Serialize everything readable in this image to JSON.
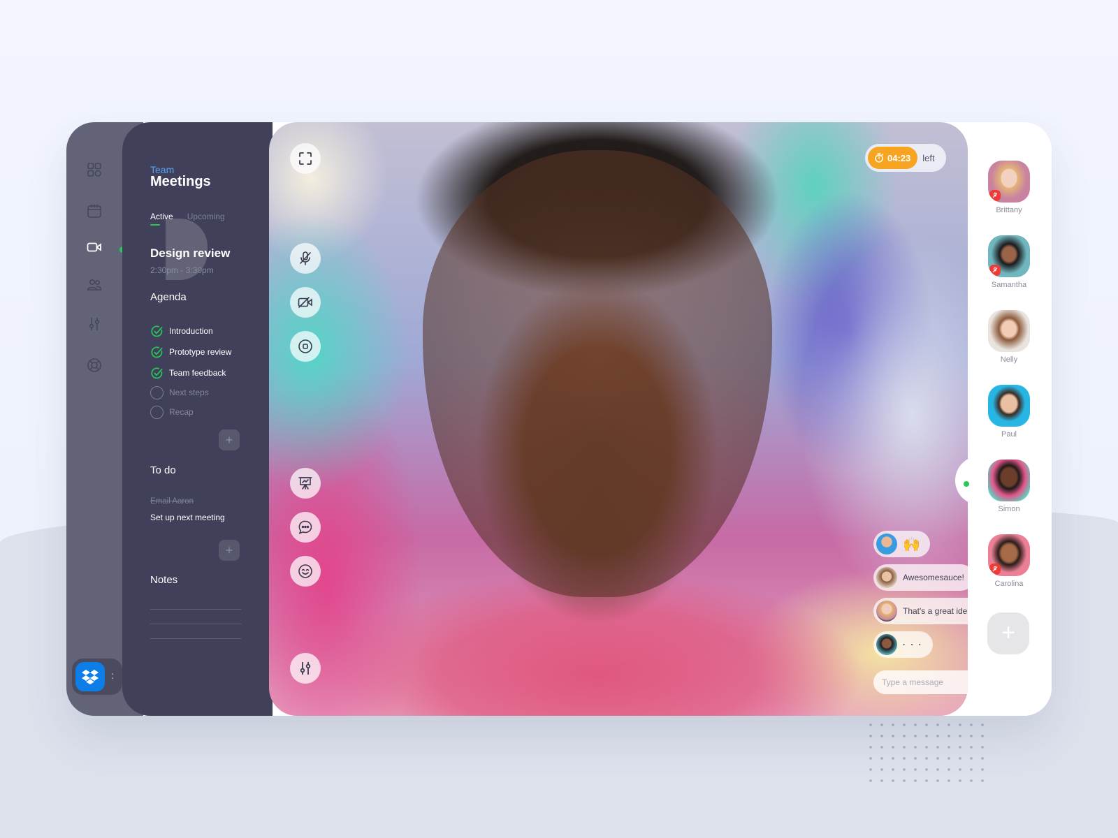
{
  "nav": {
    "icons": [
      "dashboard-icon",
      "calendar-icon",
      "video-icon",
      "users-icon",
      "sliders-icon",
      "support-icon"
    ],
    "active": "video-icon",
    "active_indicator_color": "#27c75a",
    "launcher": {
      "app": "Dropbox",
      "app_color": "#0d7ee8"
    }
  },
  "panel": {
    "eyebrow": "Team",
    "title": "Meetings",
    "tabs": [
      {
        "label": "Active",
        "active": true
      },
      {
        "label": "Upcoming",
        "active": false
      }
    ],
    "meeting": {
      "title": "Design review",
      "time": "2:30pm - 3:30pm"
    },
    "agenda": {
      "title": "Agenda",
      "items": [
        {
          "label": "Introduction",
          "done": true
        },
        {
          "label": "Prototype review",
          "done": true
        },
        {
          "label": "Team feedback",
          "done": true
        },
        {
          "label": "Next steps",
          "done": false
        },
        {
          "label": "Recap",
          "done": false
        }
      ],
      "add_label": "+"
    },
    "todo": {
      "title": "To do",
      "items": [
        {
          "label": "Email Aaron",
          "done": true
        },
        {
          "label": "Set up next meeting",
          "done": false
        }
      ],
      "add_label": "+"
    },
    "notes": {
      "title": "Notes"
    }
  },
  "stage": {
    "speaker": "Simon",
    "controls_top": [
      "fullscreen-icon"
    ],
    "controls_mid": [
      "mic-off-icon",
      "camera-off-icon",
      "record-icon"
    ],
    "controls_low": [
      "presentation-icon",
      "chat-icon",
      "emoji-icon"
    ],
    "controls_bottom": [
      "settings-sliders-icon"
    ],
    "timer": {
      "value": "04:23",
      "suffix": "left",
      "color": "#f7a520"
    },
    "chat": {
      "messages": [
        {
          "author": "Paul",
          "text": "🙌"
        },
        {
          "author": "Nelly",
          "text": "Awesomesauce!"
        },
        {
          "author": "Brittany",
          "text": "That's a great idea!"
        },
        {
          "author": "Samantha",
          "text": "· · ·"
        }
      ],
      "input_placeholder": "Type a message"
    }
  },
  "participants": {
    "people": [
      {
        "name": "Brittany",
        "muted": true
      },
      {
        "name": "Samantha",
        "muted": true
      },
      {
        "name": "Nelly",
        "muted": false
      },
      {
        "name": "Paul",
        "muted": false
      },
      {
        "name": "Simon",
        "muted": false,
        "speaking": true
      },
      {
        "name": "Carolina",
        "muted": true
      }
    ],
    "add_label": "+"
  }
}
